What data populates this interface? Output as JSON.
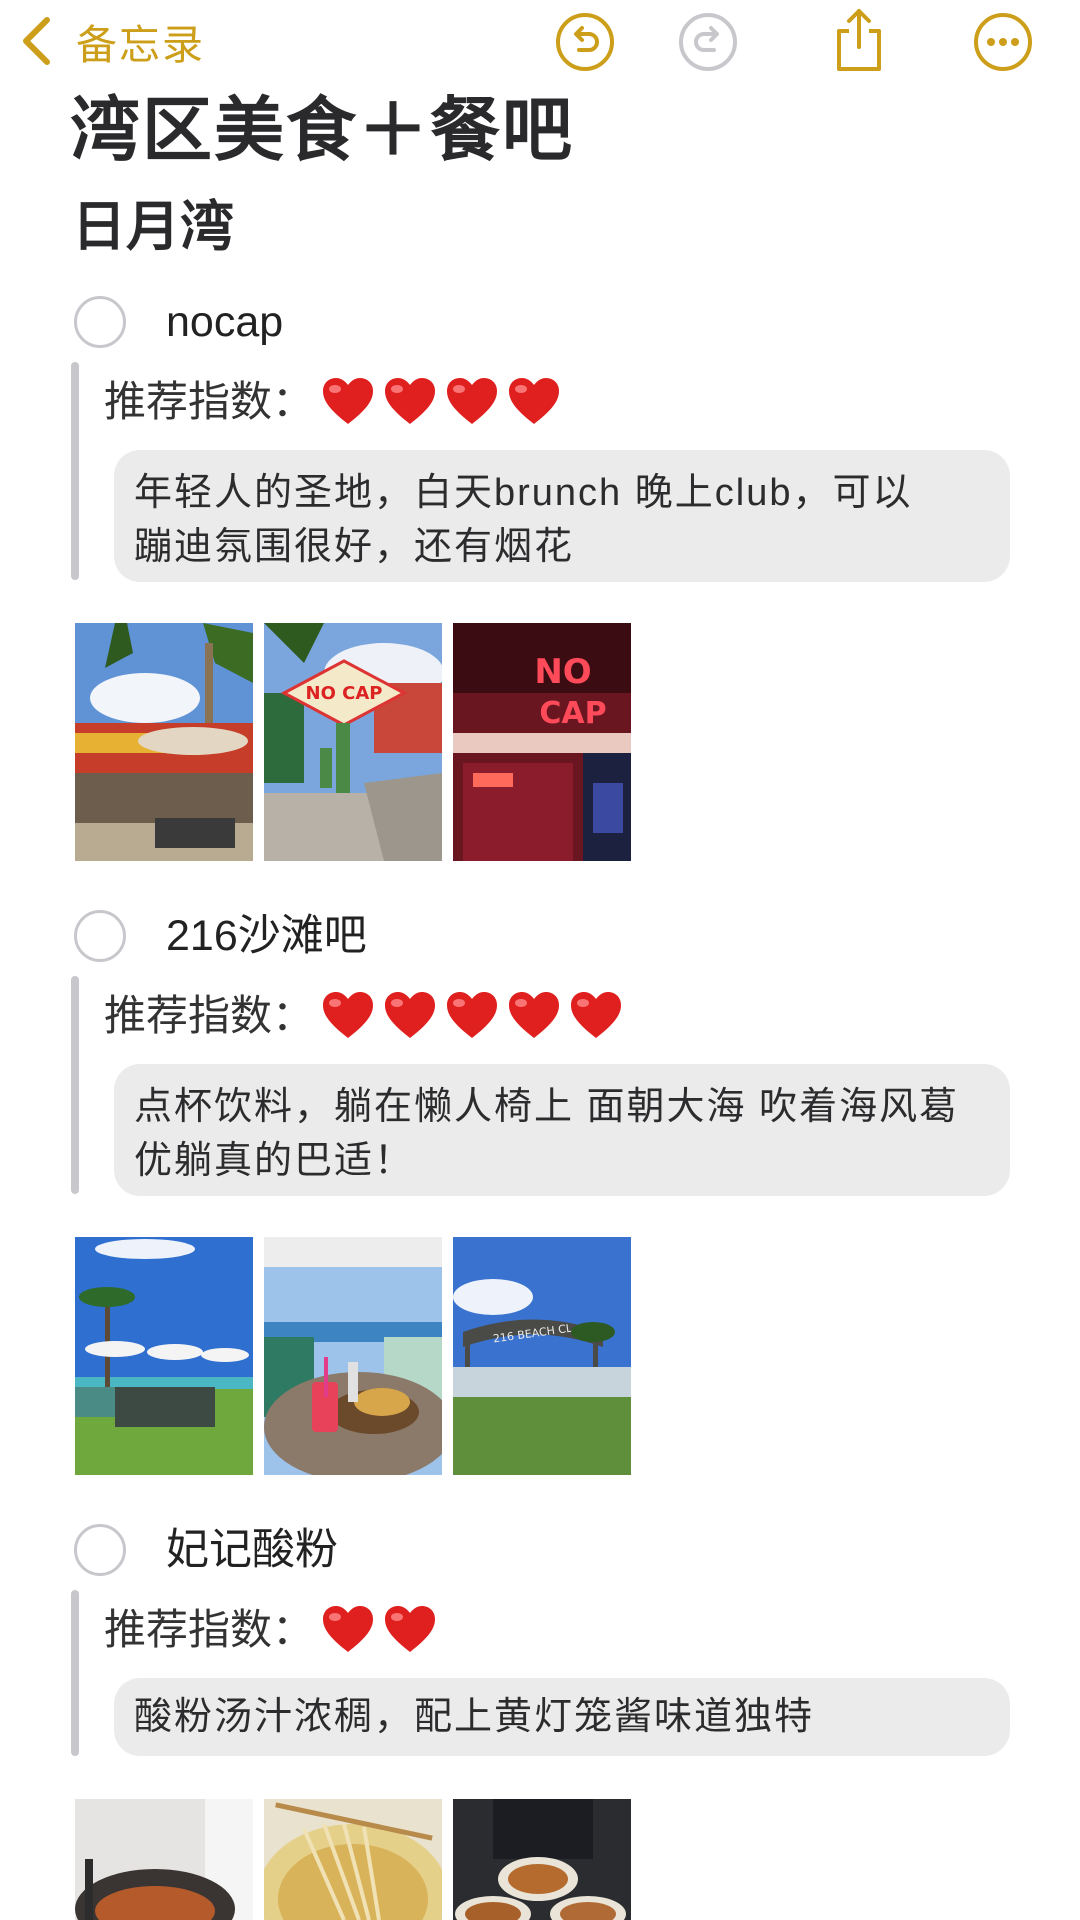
{
  "nav": {
    "back_label": "备忘录",
    "icons": [
      "chevron-left-icon",
      "undo-icon",
      "redo-icon",
      "share-icon",
      "more-icon"
    ]
  },
  "note": {
    "title": "湾区美食＋餐吧",
    "section": "日月湾"
  },
  "items": [
    {
      "title": "nocap",
      "rating_label": "推荐指数：",
      "hearts": 4,
      "description": [
        "年轻人的圣地，白天brunch 晚上club，可以",
        "蹦迪氛围很好，还有烟花"
      ],
      "photos": [
        "beach-cafe-photo",
        "nocap-sign-photo",
        "nocap-night-photo"
      ]
    },
    {
      "title": "216沙滩吧",
      "rating_label": "推荐指数：",
      "hearts": 5,
      "description": [
        "点杯饮料，躺在懒人椅上 面朝大海 吹着海风葛",
        "优躺真的巴适！"
      ],
      "photos": [
        "beach-umbrellas-photo",
        "drinks-taco-photo",
        "beach-club-sign-photo"
      ]
    },
    {
      "title": "妃记酸粉",
      "rating_label": "推荐指数：",
      "hearts": 2,
      "description": [
        "酸粉汤汁浓稠，配上黄灯笼酱味道独特"
      ],
      "photos": [
        "pot-photo",
        "noodles-photo",
        "soup-bowls-photo"
      ]
    }
  ],
  "colors": {
    "accent": "#cc9e19",
    "heart": "#e0201f",
    "note_box": "#ebebeb",
    "checkbox": "#c7c7cc"
  }
}
